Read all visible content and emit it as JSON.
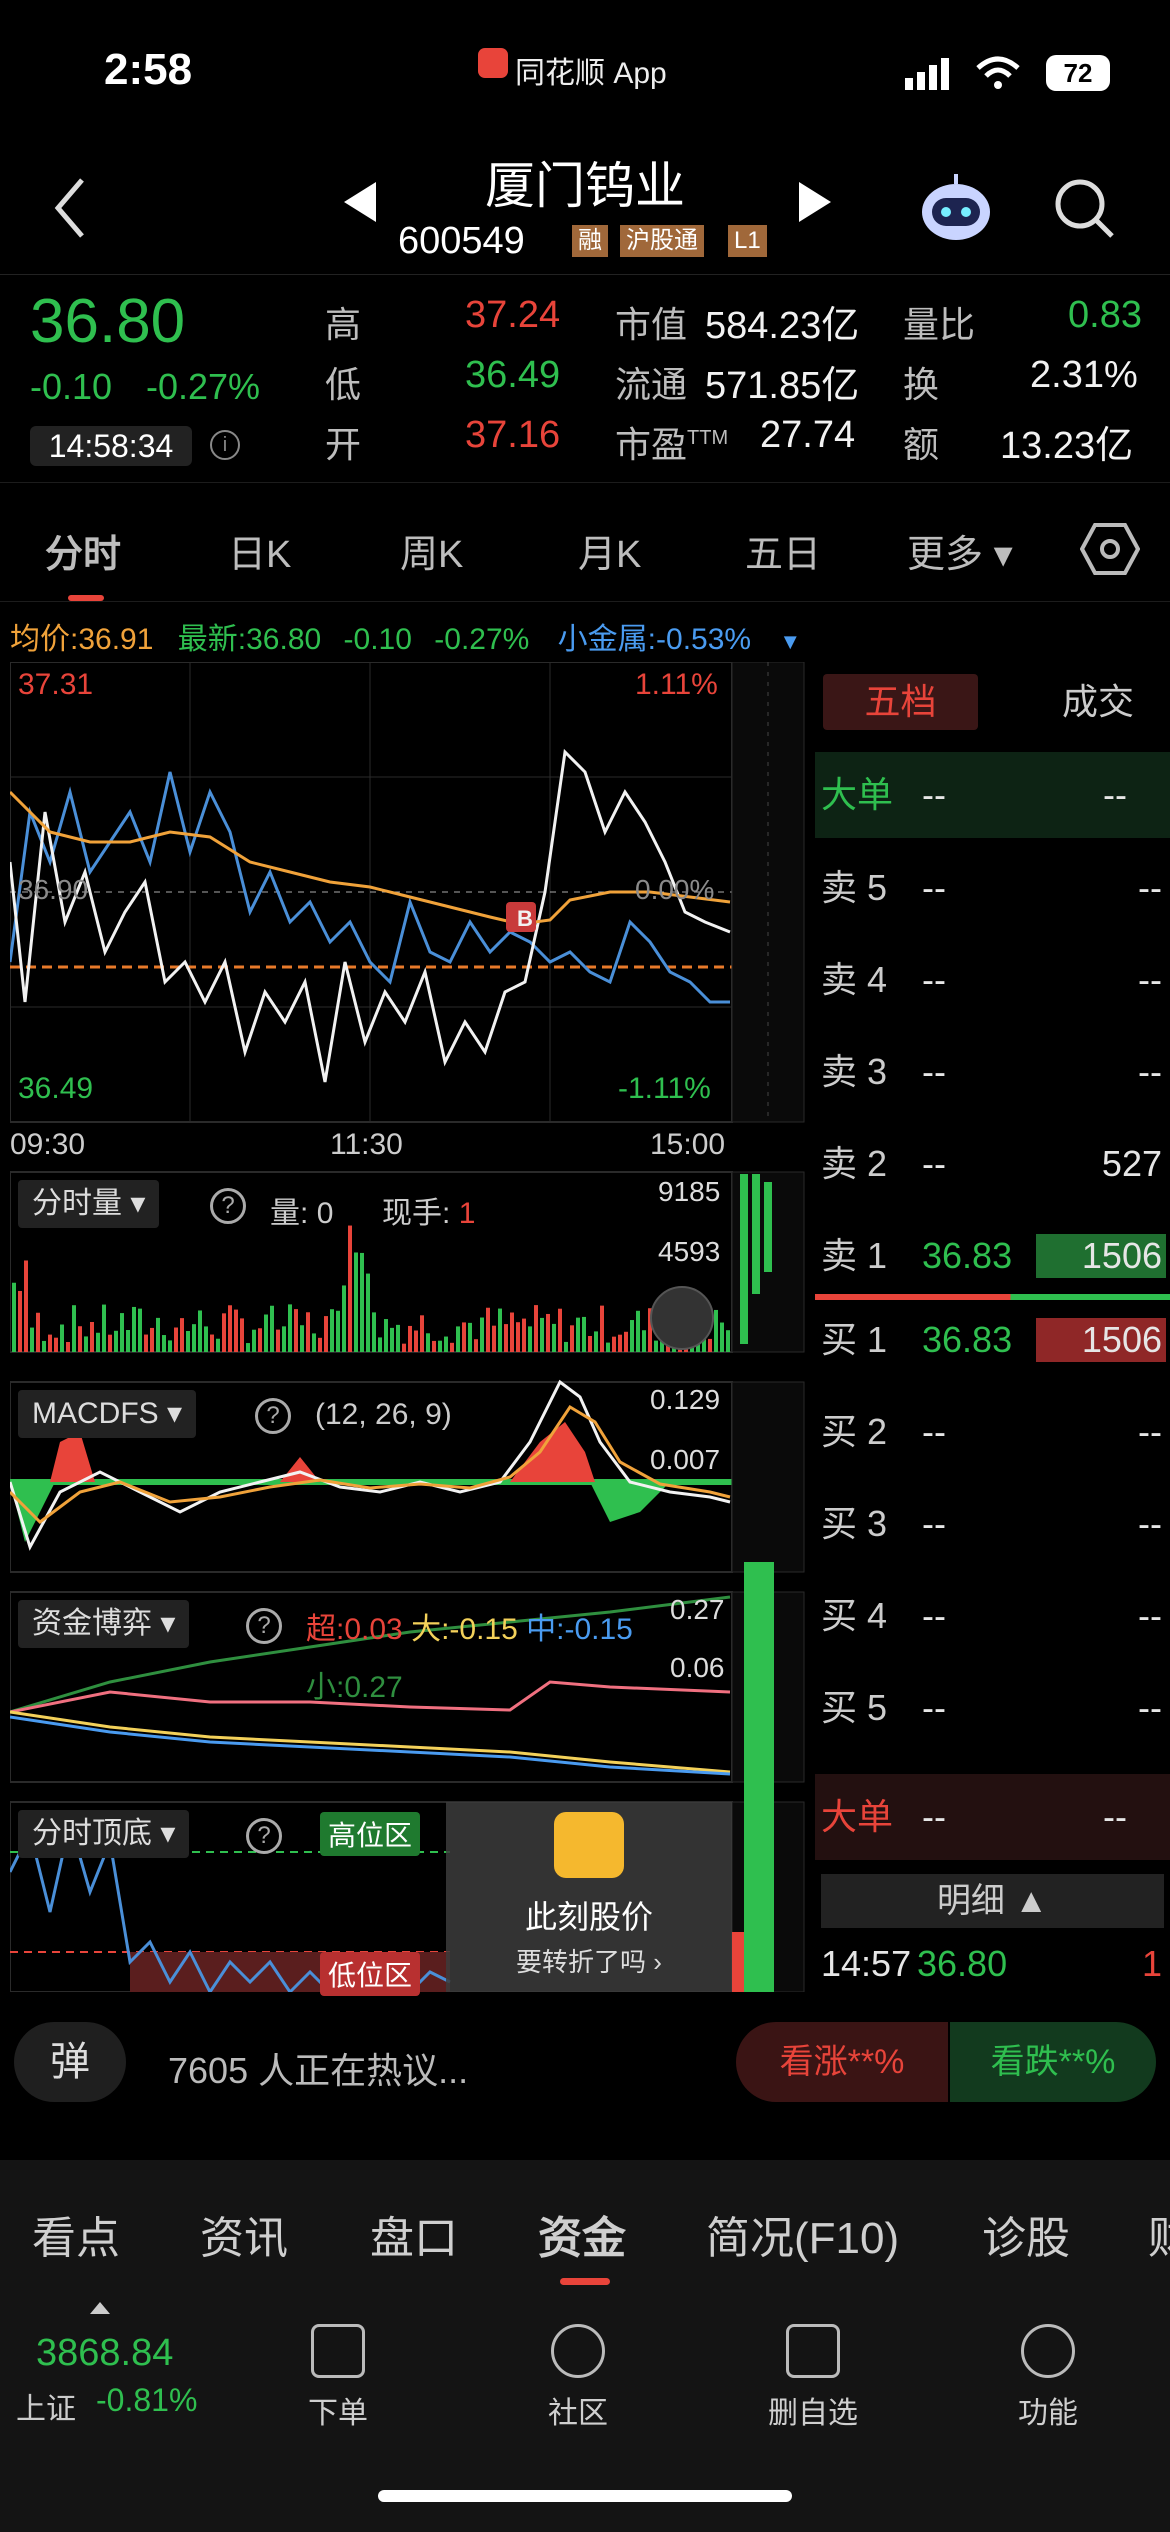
{
  "status": {
    "time": "2:58",
    "app_name": "同花顺 App",
    "battery": "72"
  },
  "header": {
    "name": "厦门钨业",
    "code": "600549",
    "tags": [
      "融",
      "沪股通",
      "L1"
    ]
  },
  "quote": {
    "price": "36.80",
    "change": "-0.10",
    "change_pct": "-0.27%",
    "timestamp": "14:58:34",
    "high_label": "高",
    "high": "37.24",
    "low_label": "低",
    "low": "36.49",
    "open_label": "开",
    "open": "37.16",
    "mktcap_label": "市值",
    "mktcap": "584.23亿",
    "float_label": "流通",
    "float": "571.85亿",
    "pe_label": "市盈",
    "pe_sup": "TTM",
    "pe": "27.74",
    "volratio_label": "量比",
    "volratio": "0.83",
    "turnover_label": "换",
    "turnover": "2.31%",
    "amount_label": "额",
    "amount": "13.23亿"
  },
  "tabs": [
    "分时",
    "日K",
    "周K",
    "月K",
    "五日",
    "更多"
  ],
  "infobar": {
    "avg_label": "均价:",
    "avg": "36.91",
    "latest_label": "最新:",
    "latest": "36.80",
    "chg": "-0.10",
    "pct": "-0.27%",
    "sector_label": "小金属:",
    "sector": "-0.53%"
  },
  "chart": {
    "y_top": "37.31",
    "y_bottom": "36.49",
    "y_mid": "36.90",
    "pct_top": "1.11%",
    "pct_bottom": "-1.11%",
    "pct_mid": "0.00%",
    "x_labels": [
      "09:30",
      "11:30",
      "15:00"
    ],
    "marker": "B"
  },
  "volume": {
    "title": "分时量",
    "vol_label": "量:",
    "vol": "0",
    "hand_label": "现手:",
    "hand": "1",
    "max": "9185",
    "mid": "4593"
  },
  "macd": {
    "title": "MACDFS",
    "params": "(12, 26, 9)",
    "top": "0.129",
    "mid": "0.007"
  },
  "fund": {
    "title": "资金博弈",
    "super": "超:0.03",
    "big": "大:-0.15",
    "mid": "中:-0.15",
    "small": "小:0.27",
    "top": "0.27",
    "v2": "0.06"
  },
  "topbottom": {
    "title": "分时顶底",
    "high_zone": "高位区",
    "low_zone": "低位区"
  },
  "promo": {
    "title": "此刻股价",
    "subtitle": "要转折了吗"
  },
  "orderbook": {
    "tabs": [
      "五档",
      "成交"
    ],
    "big_sell_label": "大单",
    "dash": "--",
    "sells": [
      {
        "label": "卖 5",
        "price": "--",
        "vol": "--"
      },
      {
        "label": "卖 4",
        "price": "--",
        "vol": "--"
      },
      {
        "label": "卖 3",
        "price": "--",
        "vol": "--"
      },
      {
        "label": "卖 2",
        "price": "--",
        "vol": "527"
      },
      {
        "label": "卖 1",
        "price": "36.83",
        "vol": "1506"
      }
    ],
    "buys": [
      {
        "label": "买 1",
        "price": "36.83",
        "vol": "1506"
      },
      {
        "label": "买 2",
        "price": "--",
        "vol": "--"
      },
      {
        "label": "买 3",
        "price": "--",
        "vol": "--"
      },
      {
        "label": "买 4",
        "price": "--",
        "vol": "--"
      },
      {
        "label": "买 5",
        "price": "--",
        "vol": "--"
      }
    ],
    "big_buy_label": "大单",
    "detail_label": "明细",
    "trade": {
      "time": "14:57",
      "price": "36.80",
      "vol": "1"
    }
  },
  "bottom": {
    "danmu": "弹",
    "discussion": "7605 人正在热议...",
    "bull": "看涨**%",
    "bear": "看跌**%"
  },
  "navtabs": [
    "看点",
    "资讯",
    "盘口",
    "资金",
    "简况(F10)",
    "诊股",
    "财"
  ],
  "dock": {
    "index_value": "3868.84",
    "index_name": "上证",
    "index_chg": "-0.81%",
    "items": [
      "下单",
      "社区",
      "删自选",
      "功能"
    ]
  }
}
